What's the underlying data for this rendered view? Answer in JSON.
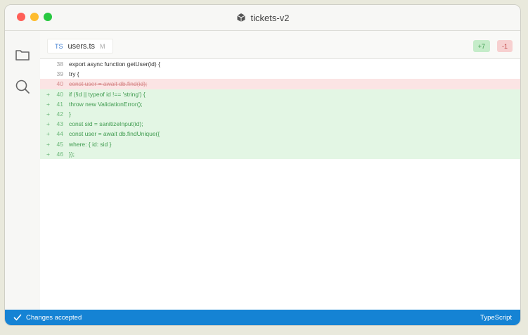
{
  "window": {
    "title": "tickets-v2"
  },
  "tab": {
    "language": "TS",
    "filename": "users.ts",
    "modified": "M"
  },
  "diff": {
    "added": "+7",
    "removed": "-1"
  },
  "code_lines": [
    {
      "num": "38",
      "marker": "",
      "kind": "ctx",
      "text": "export async function getUser(id) {"
    },
    {
      "num": "39",
      "marker": "",
      "kind": "ctx",
      "text": "try {"
    },
    {
      "num": "40",
      "marker": "",
      "kind": "del",
      "text": "const user = await db.find(id);"
    },
    {
      "num": "40",
      "marker": "+",
      "kind": "add",
      "text": "if (!id || typeof id !== 'string') {"
    },
    {
      "num": "41",
      "marker": "+",
      "kind": "add",
      "text": "throw new ValidationError();"
    },
    {
      "num": "42",
      "marker": "+",
      "kind": "add",
      "text": "}"
    },
    {
      "num": "43",
      "marker": "+",
      "kind": "add",
      "text": "const sid = sanitizeInput(id);"
    },
    {
      "num": "44",
      "marker": "+",
      "kind": "add",
      "text": "const user = await db.findUnique({"
    },
    {
      "num": "45",
      "marker": "+",
      "kind": "add",
      "text": "where: { id: sid }"
    },
    {
      "num": "46",
      "marker": "+",
      "kind": "add",
      "text": "});"
    }
  ],
  "status": {
    "message": "Changes accepted",
    "language": "TypeScript"
  },
  "icons": {
    "folder": "folder-icon",
    "search": "search-icon",
    "check": "check-icon",
    "app": "cube-icon"
  },
  "colors": {
    "accent": "#1583d4",
    "added_bg": "#e3f6e4",
    "removed_bg": "#fbe4e4"
  }
}
